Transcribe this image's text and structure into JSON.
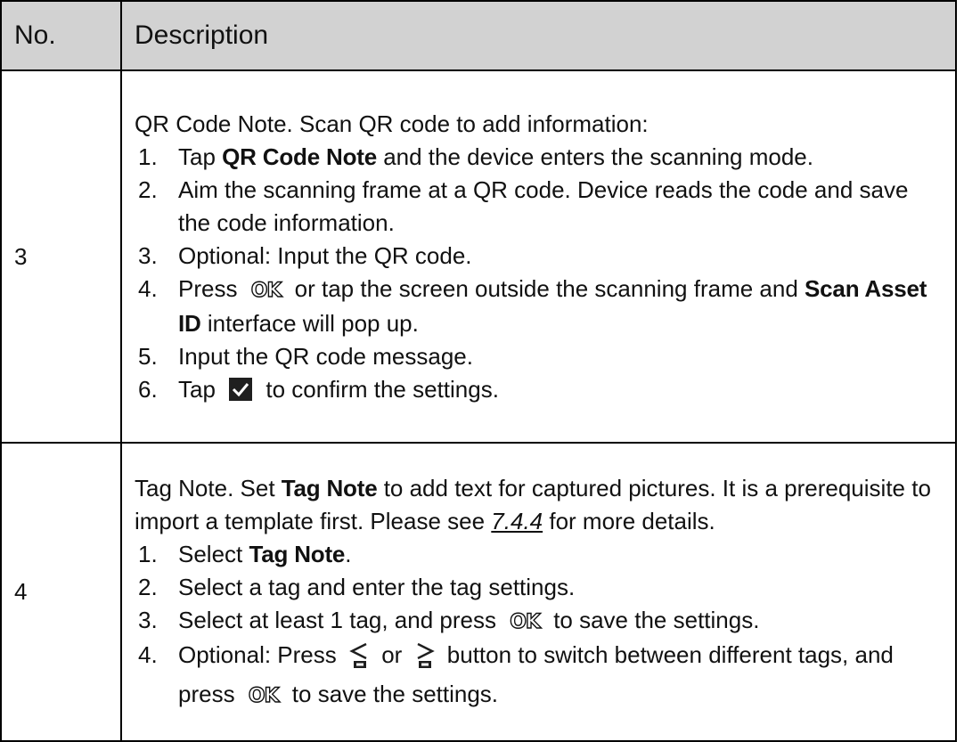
{
  "table": {
    "header": {
      "no": "No.",
      "description": "Description"
    },
    "row3": {
      "no": "3",
      "intro": "QR Code Note. Scan QR code to add information:",
      "steps": [
        {
          "num": "1.",
          "t1": "Tap ",
          "b1": "QR Code Note",
          "t2": " and the device enters the scanning mode."
        },
        {
          "num": "2.",
          "text": "Aim the scanning frame at a QR code. Device reads the code and save the code information."
        },
        {
          "num": "3.",
          "text": "Optional: Input the QR code."
        },
        {
          "num": "4.",
          "t1": "Press ",
          "key": "OK",
          "t2": " or tap the screen outside the scanning frame and ",
          "b1": "Scan Asset ID",
          "t3": " interface will pop up."
        },
        {
          "num": "5.",
          "text": "Input the QR code message."
        },
        {
          "num": "6.",
          "t1": "Tap ",
          "t2": " to confirm the settings."
        }
      ]
    },
    "row4": {
      "no": "4",
      "intro_t1": "Tag Note. Set ",
      "intro_b1": "Tag Note",
      "intro_t2": " to add text for captured pictures. It is a prerequisite to import a template first. Please see ",
      "intro_link": "7.4.4",
      "intro_t3": " for more details.",
      "steps": [
        {
          "num": "1.",
          "t1": "Select ",
          "b1": "Tag Note",
          "t2": "."
        },
        {
          "num": "2.",
          "text": "Select a tag and enter the tag settings."
        },
        {
          "num": "3.",
          "t1": "Select at least 1 tag, and press ",
          "key": "OK",
          "t2": " to save the settings."
        },
        {
          "num": "4.",
          "t1": "Optional: Press ",
          "t2": " or ",
          "t3": " button to switch between different tags, and press ",
          "key": "OK",
          "t4": " to save the settings."
        }
      ]
    }
  },
  "icons": {
    "confirm": "checkmark-icon",
    "left": "left-arrow-button-icon",
    "right": "right-arrow-button-icon",
    "icon_color": "#1f1f1f"
  },
  "colors": {
    "header_bg": "#d2d2d2",
    "border": "#000000"
  }
}
